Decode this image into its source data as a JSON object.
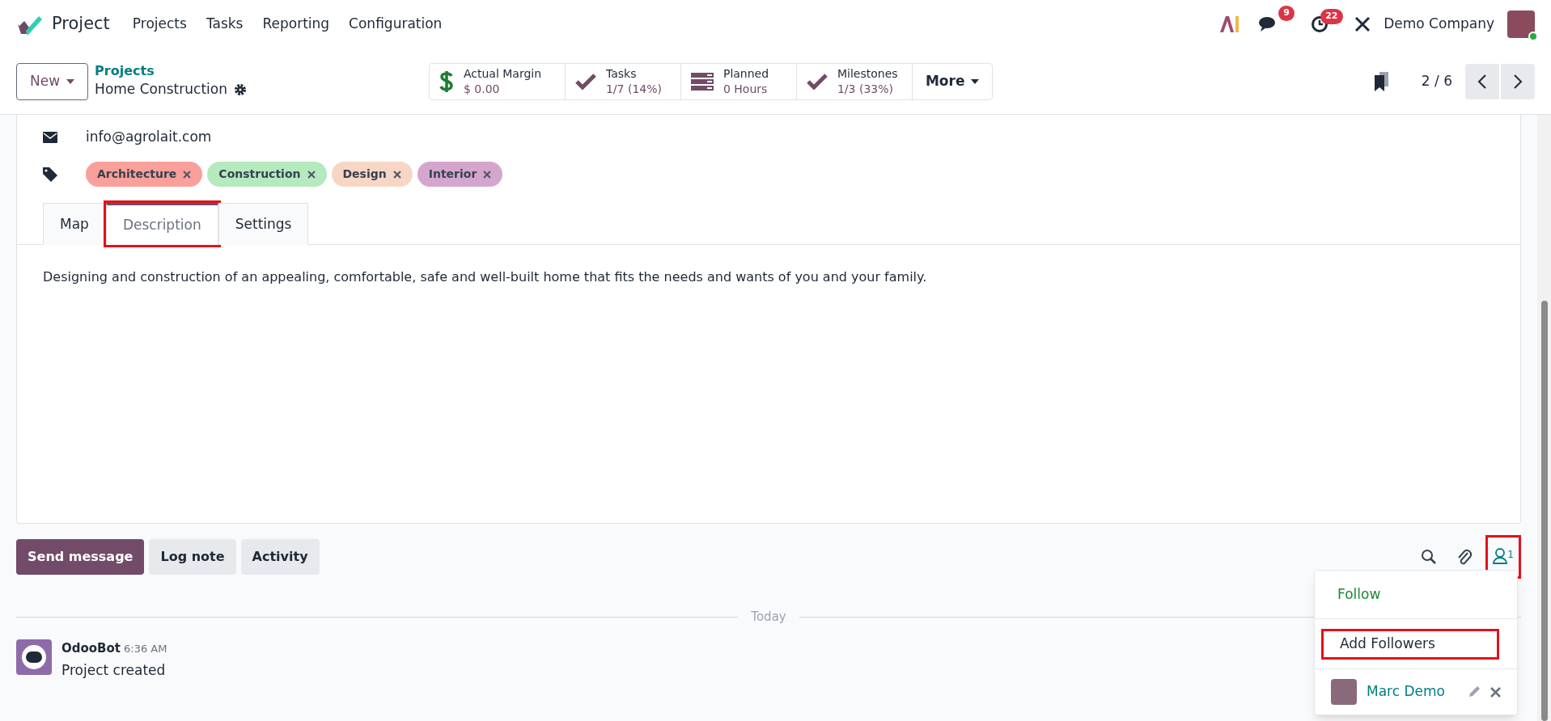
{
  "navbar": {
    "app_name": "Project",
    "menu": [
      "Projects",
      "Tasks",
      "Reporting",
      "Configuration"
    ],
    "messages_count": "9",
    "activities_count": "22",
    "company": "Demo Company"
  },
  "control_panel": {
    "new_button": "New",
    "breadcrumb": "Projects",
    "record_title": "Home Construction",
    "pager": "2 / 6"
  },
  "stat_buttons": [
    {
      "kind": "dollar",
      "label": "Actual Margin",
      "value": "$ 0.00"
    },
    {
      "kind": "check",
      "label": "Tasks",
      "value": "1/7 (14%)"
    },
    {
      "kind": "bars",
      "label": "Planned",
      "value": "0 Hours"
    },
    {
      "kind": "check",
      "label": "Milestones",
      "value": "1/3 (33%)"
    }
  ],
  "more_button": "More",
  "form": {
    "email": "info@agrolait.com",
    "tags": [
      {
        "label": "Architecture",
        "color": "#f9a09a"
      },
      {
        "label": "Construction",
        "color": "#b5e9be"
      },
      {
        "label": "Design",
        "color": "#f7d6c6"
      },
      {
        "label": "Interior",
        "color": "#d4a5cd"
      }
    ],
    "tabs": [
      {
        "label": "Map",
        "selected": false,
        "highlighted": false
      },
      {
        "label": "Description",
        "selected": true,
        "highlighted": true
      },
      {
        "label": "Settings",
        "selected": false,
        "highlighted": false
      }
    ],
    "description": "Designing and construction of an appealing, comfortable, safe and well-built home that fits the needs and wants of you and your family."
  },
  "chatter": {
    "buttons": [
      {
        "label": "Send message",
        "selected": true
      },
      {
        "label": "Log note",
        "selected": false
      },
      {
        "label": "Activity",
        "selected": false
      }
    ],
    "followers_count": "1",
    "followers_highlighted": true,
    "date_separator": "Today",
    "messages": [
      {
        "author": "OdooBot",
        "time": "6:36 AM",
        "body": "Project created"
      }
    ]
  },
  "followers_menu": {
    "follow": "Follow",
    "add_followers": "Add Followers",
    "add_followers_highlighted": true,
    "followers": [
      {
        "name": "Marc Demo"
      }
    ]
  }
}
